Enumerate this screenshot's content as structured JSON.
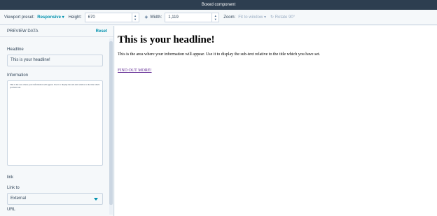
{
  "window": {
    "title": "Boxed component"
  },
  "toolbar": {
    "viewport_label": "Viewport preset:",
    "viewport_value": "Responsive",
    "height_label": "Height:",
    "height_value": "670",
    "width_label": "Width:",
    "width_value": "1,119",
    "zoom_label": "Zoom:",
    "zoom_value": "Fit to window",
    "rotate_label": "Rotate 90°"
  },
  "sidebar": {
    "title": "PREVIEW DATA",
    "reset_label": "Reset",
    "headline_label": "Headline",
    "headline_value": "This is your headline!",
    "information_label": "Information",
    "information_value": "This is the area where your information will appear. Use it to display the sub-text relative to the title which you have set.",
    "link_section_label": "link",
    "link_to_label": "Link to",
    "link_to_value": "External",
    "url_label": "URL"
  },
  "preview": {
    "headline": "This is your headline!",
    "body": "This is the area where your information will appear. Use it to display the sub-text relative to the title which you have set.",
    "link": "FIND OUT MORE!"
  }
}
